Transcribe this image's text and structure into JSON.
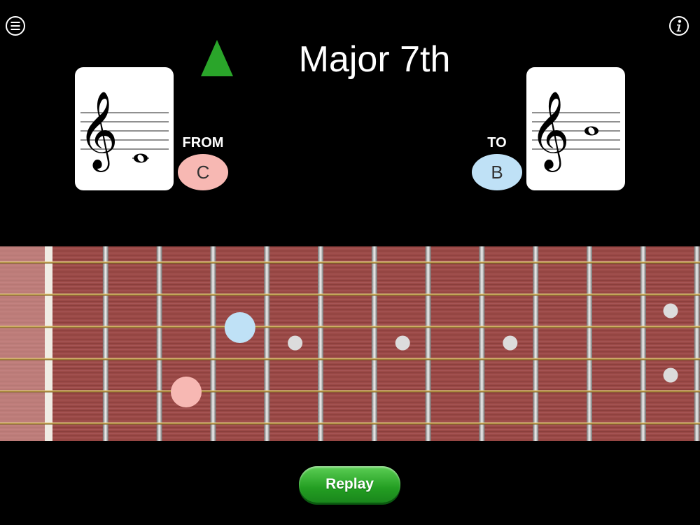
{
  "header": {
    "title": "Major 7th",
    "menu_icon": "hamburger-menu-icon",
    "info_icon": "info-icon",
    "direction_icon": "up-arrow-icon"
  },
  "from_note": {
    "caption": "FROM",
    "note": "C",
    "color": "#f7b8b3",
    "staff": "treble",
    "pitch": "C4"
  },
  "to_note": {
    "caption": "TO",
    "note": "B",
    "color": "#bfe1f6",
    "staff": "treble",
    "pitch": "B4"
  },
  "fretboard": {
    "strings": 6,
    "visible_frets": 12,
    "from_position": {
      "string": 5,
      "fret": 3
    },
    "to_position": {
      "string": 3,
      "fret": 4
    },
    "inlay_frets": [
      5,
      7,
      9,
      12
    ]
  },
  "controls": {
    "replay_label": "Replay"
  },
  "colors": {
    "accent_green": "#2aa52a",
    "from": "#f7b8b3",
    "to": "#bfe1f6",
    "wood": "#9b4a47"
  }
}
